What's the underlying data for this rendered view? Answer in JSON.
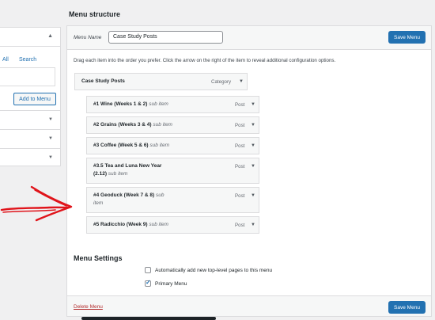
{
  "left_panel": {
    "tab_all": "All",
    "tab_search": "Search",
    "add_button": "Add to Menu"
  },
  "page": {
    "title": "Menu structure",
    "menu_name_label": "Menu Name",
    "menu_name_value": "Case Study Posts",
    "save_label": "Save Menu",
    "instructions": "Drag each item into the order you prefer. Click the arrow on the right of the item to reveal additional configuration options."
  },
  "menu_items": [
    {
      "title": "Case Study Posts",
      "sub": "",
      "type": "Category"
    },
    {
      "title": "#1 Wine (Weeks 1 & 2)",
      "sub": "sub item",
      "type": "Post"
    },
    {
      "title": "#2 Grains (Weeks 3 & 4)",
      "sub": "sub item",
      "type": "Post"
    },
    {
      "title": "#3 Coffee (Week 5 & 6)",
      "sub": "sub item",
      "type": "Post"
    },
    {
      "title": "#3.5 Tea and Luna New Year",
      "title_line2": "(2.12)",
      "sub": "sub item",
      "type": "Post"
    },
    {
      "title": "#4 Geoduck (Week 7 & 8)",
      "sub_line1": "sub",
      "sub_line2": "item",
      "type": "Post"
    },
    {
      "title": "#5 Radicchio (Week 9)",
      "sub": "sub item",
      "type": "Post"
    }
  ],
  "settings": {
    "title": "Menu Settings",
    "auto_add_label": "Automatically add new top-level pages to this menu",
    "auto_add_checked": false,
    "primary_label": "Primary Menu",
    "primary_checked": true
  },
  "footer": {
    "delete_label": "Delete Menu",
    "save_label": "Save Menu"
  },
  "colors": {
    "accent": "#2271b1",
    "delete": "#b32d2e",
    "annotation": "#e0141b"
  },
  "icons": {
    "expand": "triangle-down",
    "collapse": "triangle-up"
  }
}
